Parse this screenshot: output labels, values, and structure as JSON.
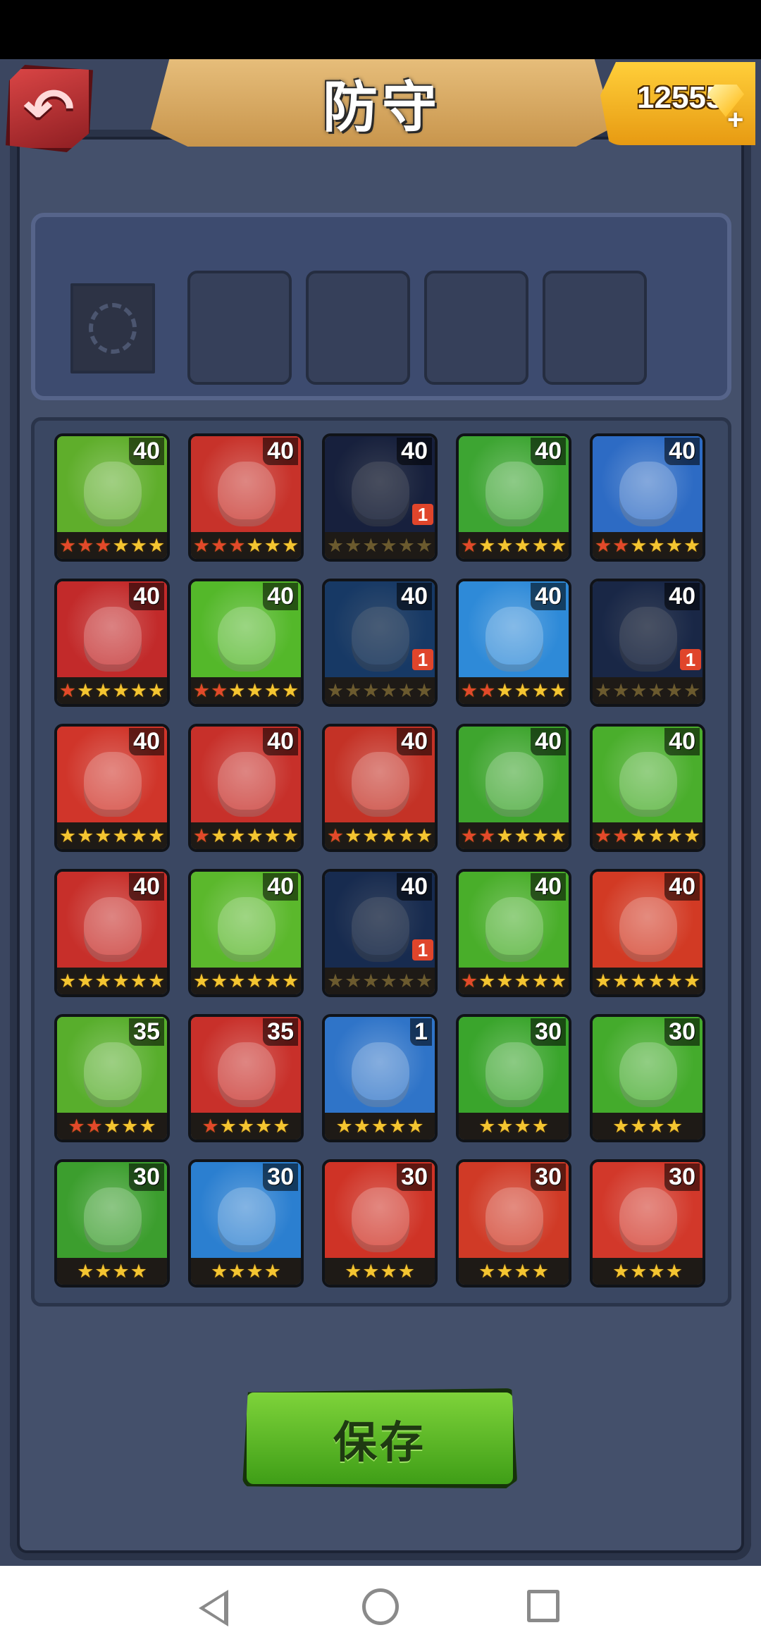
{
  "header": {
    "title": "防守",
    "back_icon": "back-arrow-icon",
    "gems": {
      "count": "12555",
      "icon": "gem-icon",
      "plus": "+"
    }
  },
  "team_slots": [
    {
      "state": "locked",
      "icon": "lock-emblem-icon"
    },
    {
      "state": "empty"
    },
    {
      "state": "empty"
    },
    {
      "state": "empty"
    },
    {
      "state": "empty"
    }
  ],
  "heroes": [
    {
      "level": "40",
      "stars": 6,
      "red": 3,
      "badge": "",
      "color": "#5fae2b",
      "dim": false
    },
    {
      "level": "40",
      "stars": 6,
      "red": 3,
      "badge": "",
      "color": "#c7322a",
      "dim": false
    },
    {
      "level": "40",
      "stars": 6,
      "red": 3,
      "badge": "1",
      "color": "#2a3b6e",
      "dim": true
    },
    {
      "level": "40",
      "stars": 6,
      "red": 1,
      "badge": "",
      "color": "#3da532",
      "dim": false
    },
    {
      "level": "40",
      "stars": 6,
      "red": 2,
      "badge": "",
      "color": "#2d6bc4",
      "dim": false
    },
    {
      "level": "40",
      "stars": 6,
      "red": 1,
      "badge": "",
      "color": "#c22a2a",
      "dim": false
    },
    {
      "level": "40",
      "stars": 6,
      "red": 2,
      "badge": "",
      "color": "#54b82a",
      "dim": false
    },
    {
      "level": "40",
      "stars": 6,
      "red": 2,
      "badge": "1",
      "color": "#2a68b8",
      "dim": true
    },
    {
      "level": "40",
      "stars": 6,
      "red": 2,
      "badge": "",
      "color": "#2e8ad8",
      "dim": false
    },
    {
      "level": "40",
      "stars": 6,
      "red": 2,
      "badge": "1",
      "color": "#2d4780",
      "dim": true
    },
    {
      "level": "40",
      "stars": 6,
      "red": 0,
      "badge": "",
      "color": "#d0352a",
      "dim": false
    },
    {
      "level": "40",
      "stars": 6,
      "red": 1,
      "badge": "",
      "color": "#c7302a",
      "dim": false
    },
    {
      "level": "40",
      "stars": 6,
      "red": 1,
      "badge": "",
      "color": "#c43226",
      "dim": false
    },
    {
      "level": "40",
      "stars": 6,
      "red": 2,
      "badge": "",
      "color": "#3ea52e",
      "dim": false
    },
    {
      "level": "40",
      "stars": 6,
      "red": 2,
      "badge": "",
      "color": "#4aae2c",
      "dim": false
    },
    {
      "level": "40",
      "stars": 6,
      "red": 0,
      "badge": "",
      "color": "#c72f2a",
      "dim": false
    },
    {
      "level": "40",
      "stars": 6,
      "red": 0,
      "badge": "",
      "color": "#5bb82c",
      "dim": false
    },
    {
      "level": "40",
      "stars": 6,
      "red": 0,
      "badge": "1",
      "color": "#2a4e90",
      "dim": true
    },
    {
      "level": "40",
      "stars": 6,
      "red": 1,
      "badge": "",
      "color": "#49ae2a",
      "dim": false
    },
    {
      "level": "40",
      "stars": 6,
      "red": 0,
      "badge": "",
      "color": "#d23a24",
      "dim": false
    },
    {
      "level": "35",
      "stars": 5,
      "red": 2,
      "badge": "",
      "color": "#58ae2c",
      "dim": false
    },
    {
      "level": "35",
      "stars": 5,
      "red": 1,
      "badge": "",
      "color": "#c8302a",
      "dim": false
    },
    {
      "level": "1",
      "stars": 5,
      "red": 0,
      "badge": "",
      "color": "#2f74c8",
      "dim": false
    },
    {
      "level": "30",
      "stars": 4,
      "red": 0,
      "badge": "",
      "color": "#3aa52c",
      "dim": false
    },
    {
      "level": "30",
      "stars": 4,
      "red": 0,
      "badge": "",
      "color": "#44ab2c",
      "dim": false
    },
    {
      "level": "30",
      "stars": 4,
      "red": 0,
      "badge": "",
      "color": "#3c9e2e",
      "dim": false
    },
    {
      "level": "30",
      "stars": 4,
      "red": 0,
      "badge": "",
      "color": "#2b7fd0",
      "dim": false
    },
    {
      "level": "30",
      "stars": 4,
      "red": 0,
      "badge": "",
      "color": "#cf3326",
      "dim": false
    },
    {
      "level": "30",
      "stars": 4,
      "red": 0,
      "badge": "",
      "color": "#d03a26",
      "dim": false
    },
    {
      "level": "30",
      "stars": 4,
      "red": 0,
      "badge": "",
      "color": "#d2382a",
      "dim": false
    }
  ],
  "save_label": "保存",
  "nav": {
    "back_icon": "nav-back-icon",
    "home_icon": "nav-home-icon",
    "recents_icon": "nav-recents-icon"
  }
}
